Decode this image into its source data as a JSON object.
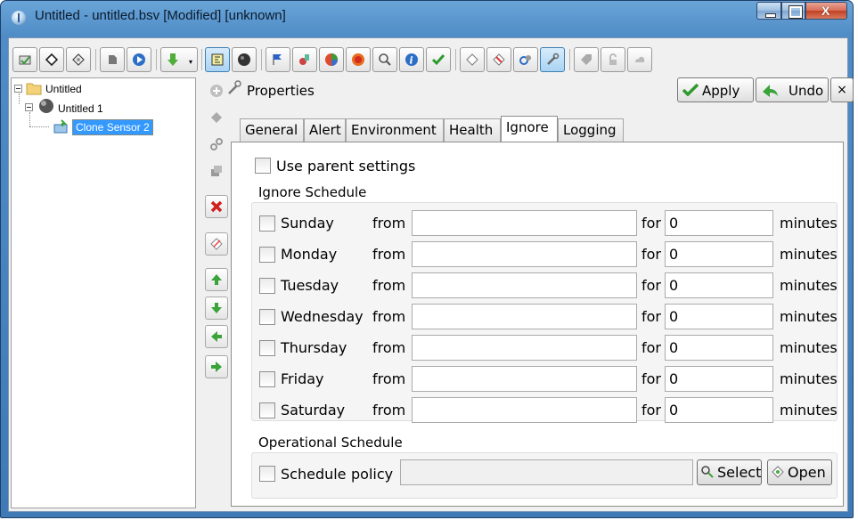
{
  "window": {
    "title": "Untitled - untitled.bsv [Modified] [unknown]"
  },
  "toolbar": {
    "icons": [
      "new-doc-icon",
      "open-icon",
      "save-icon",
      "monitor-icon",
      "play-icon",
      "download-icon",
      "layout-icon",
      "globe-icon",
      "flag-icon",
      "tools-icon",
      "pie-chart-icon",
      "alarm-icon",
      "search-icon",
      "info-icon",
      "check-icon",
      "tag-icon",
      "calendar-icon",
      "link-icon",
      "wrench-icon",
      "tag2-icon",
      "lock-icon",
      "cloud-icon"
    ]
  },
  "tree": {
    "root": "Untitled",
    "child": "Untitled 1",
    "leaf": "Clone Sensor 2"
  },
  "panel": {
    "title": "Properties",
    "apply": "Apply",
    "undo": "Undo",
    "close": "×"
  },
  "tabs": [
    {
      "label": "General",
      "active": false
    },
    {
      "label": "Alert",
      "active": false
    },
    {
      "label": "Environment",
      "active": false
    },
    {
      "label": "Health",
      "active": false
    },
    {
      "label": "Ignore",
      "active": true
    },
    {
      "label": "Logging",
      "active": false
    }
  ],
  "ignore": {
    "use_parent": "Use parent settings",
    "schedule_title": "Ignore Schedule",
    "from": "from",
    "for": "for",
    "minutes": "minutes",
    "days": [
      {
        "day": "Sunday",
        "from": "",
        "for": "0"
      },
      {
        "day": "Monday",
        "from": "",
        "for": "0"
      },
      {
        "day": "Tuesday",
        "from": "",
        "for": "0"
      },
      {
        "day": "Wednesday",
        "from": "",
        "for": "0"
      },
      {
        "day": "Thursday",
        "from": "",
        "for": "0"
      },
      {
        "day": "Friday",
        "from": "",
        "for": "0"
      },
      {
        "day": "Saturday",
        "from": "",
        "for": "0"
      }
    ],
    "operational_title": "Operational Schedule",
    "schedule_label": "Schedule",
    "policy_label": "policy",
    "policy_value": "",
    "select_button": "Select",
    "open_button": "Open"
  },
  "colors": {
    "titlebar": "#4f8cc6",
    "selection": "#3399ff",
    "close_button": "#c14024"
  }
}
